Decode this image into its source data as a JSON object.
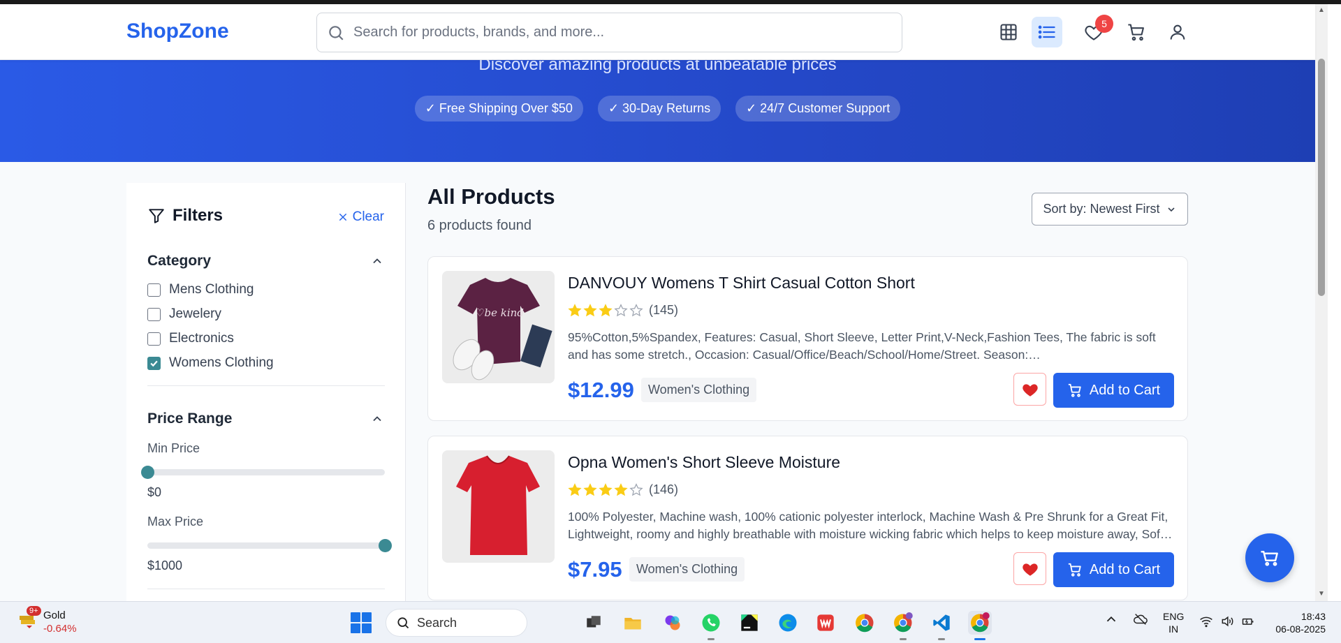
{
  "header": {
    "logo": "ShopZone",
    "search_placeholder": "Search for products, brands, and more...",
    "wishlist_count": "5"
  },
  "hero": {
    "subtitle": "Discover amazing products at unbeatable prices",
    "chips": [
      "✓ Free Shipping Over $50",
      "✓ 30-Day Returns",
      "✓ 24/7 Customer Support"
    ]
  },
  "filters": {
    "title": "Filters",
    "clear_label": "Clear",
    "category_title": "Category",
    "categories": [
      {
        "label": "Mens Clothing",
        "checked": false
      },
      {
        "label": "Jewelery",
        "checked": false
      },
      {
        "label": "Electronics",
        "checked": false
      },
      {
        "label": "Womens Clothing",
        "checked": true
      }
    ],
    "price_title": "Price Range",
    "min_label": "Min Price",
    "min_value": "$0",
    "min_fraction": 0,
    "max_label": "Max Price",
    "max_value": "$1000",
    "max_fraction": 1
  },
  "main": {
    "title": "All Products",
    "count": "6 products found",
    "sort_label": "Sort by: Newest First"
  },
  "products": [
    {
      "title": "DANVOUY Womens T Shirt Casual Cotton Short",
      "rating": 3,
      "reviews": "(145)",
      "description": "95%Cotton,5%Spandex, Features: Casual, Short Sleeve, Letter Print,V-Neck,Fashion Tees, The fabric is soft and has some stretch., Occasion: Casual/Office/Beach/School/Home/Street. Season: Spring,Summer,Autumn,Winter.",
      "price": "$12.99",
      "category": "Women's Clothing",
      "shirt_text": "♡be kind",
      "add_label": "Add to Cart"
    },
    {
      "title": "Opna Women's Short Sleeve Moisture",
      "rating": 4,
      "reviews": "(146)",
      "description": "100% Polyester, Machine wash, 100% cationic polyester interlock, Machine Wash & Pre Shrunk for a Great Fit, Lightweight, roomy and highly breathable with moisture wicking fabric which helps to keep moisture away, Soft Lightweight Fabric with comfortable V-neck collar and a slimmer fit.",
      "price": "$7.95",
      "category": "Women's Clothing",
      "add_label": "Add to Cart"
    }
  ],
  "taskbar": {
    "weather_name": "Gold",
    "weather_change": "-0.64%",
    "weather_badge": "9+",
    "search_label": "Search",
    "lang_1": "ENG",
    "lang_2": "IN",
    "time": "18:43",
    "date": "06-08-2025"
  },
  "colors": {
    "brand": "#2563eb",
    "accent_checkbox": "#3b8a93",
    "heart": "#dc2626",
    "star": "#facc15"
  }
}
